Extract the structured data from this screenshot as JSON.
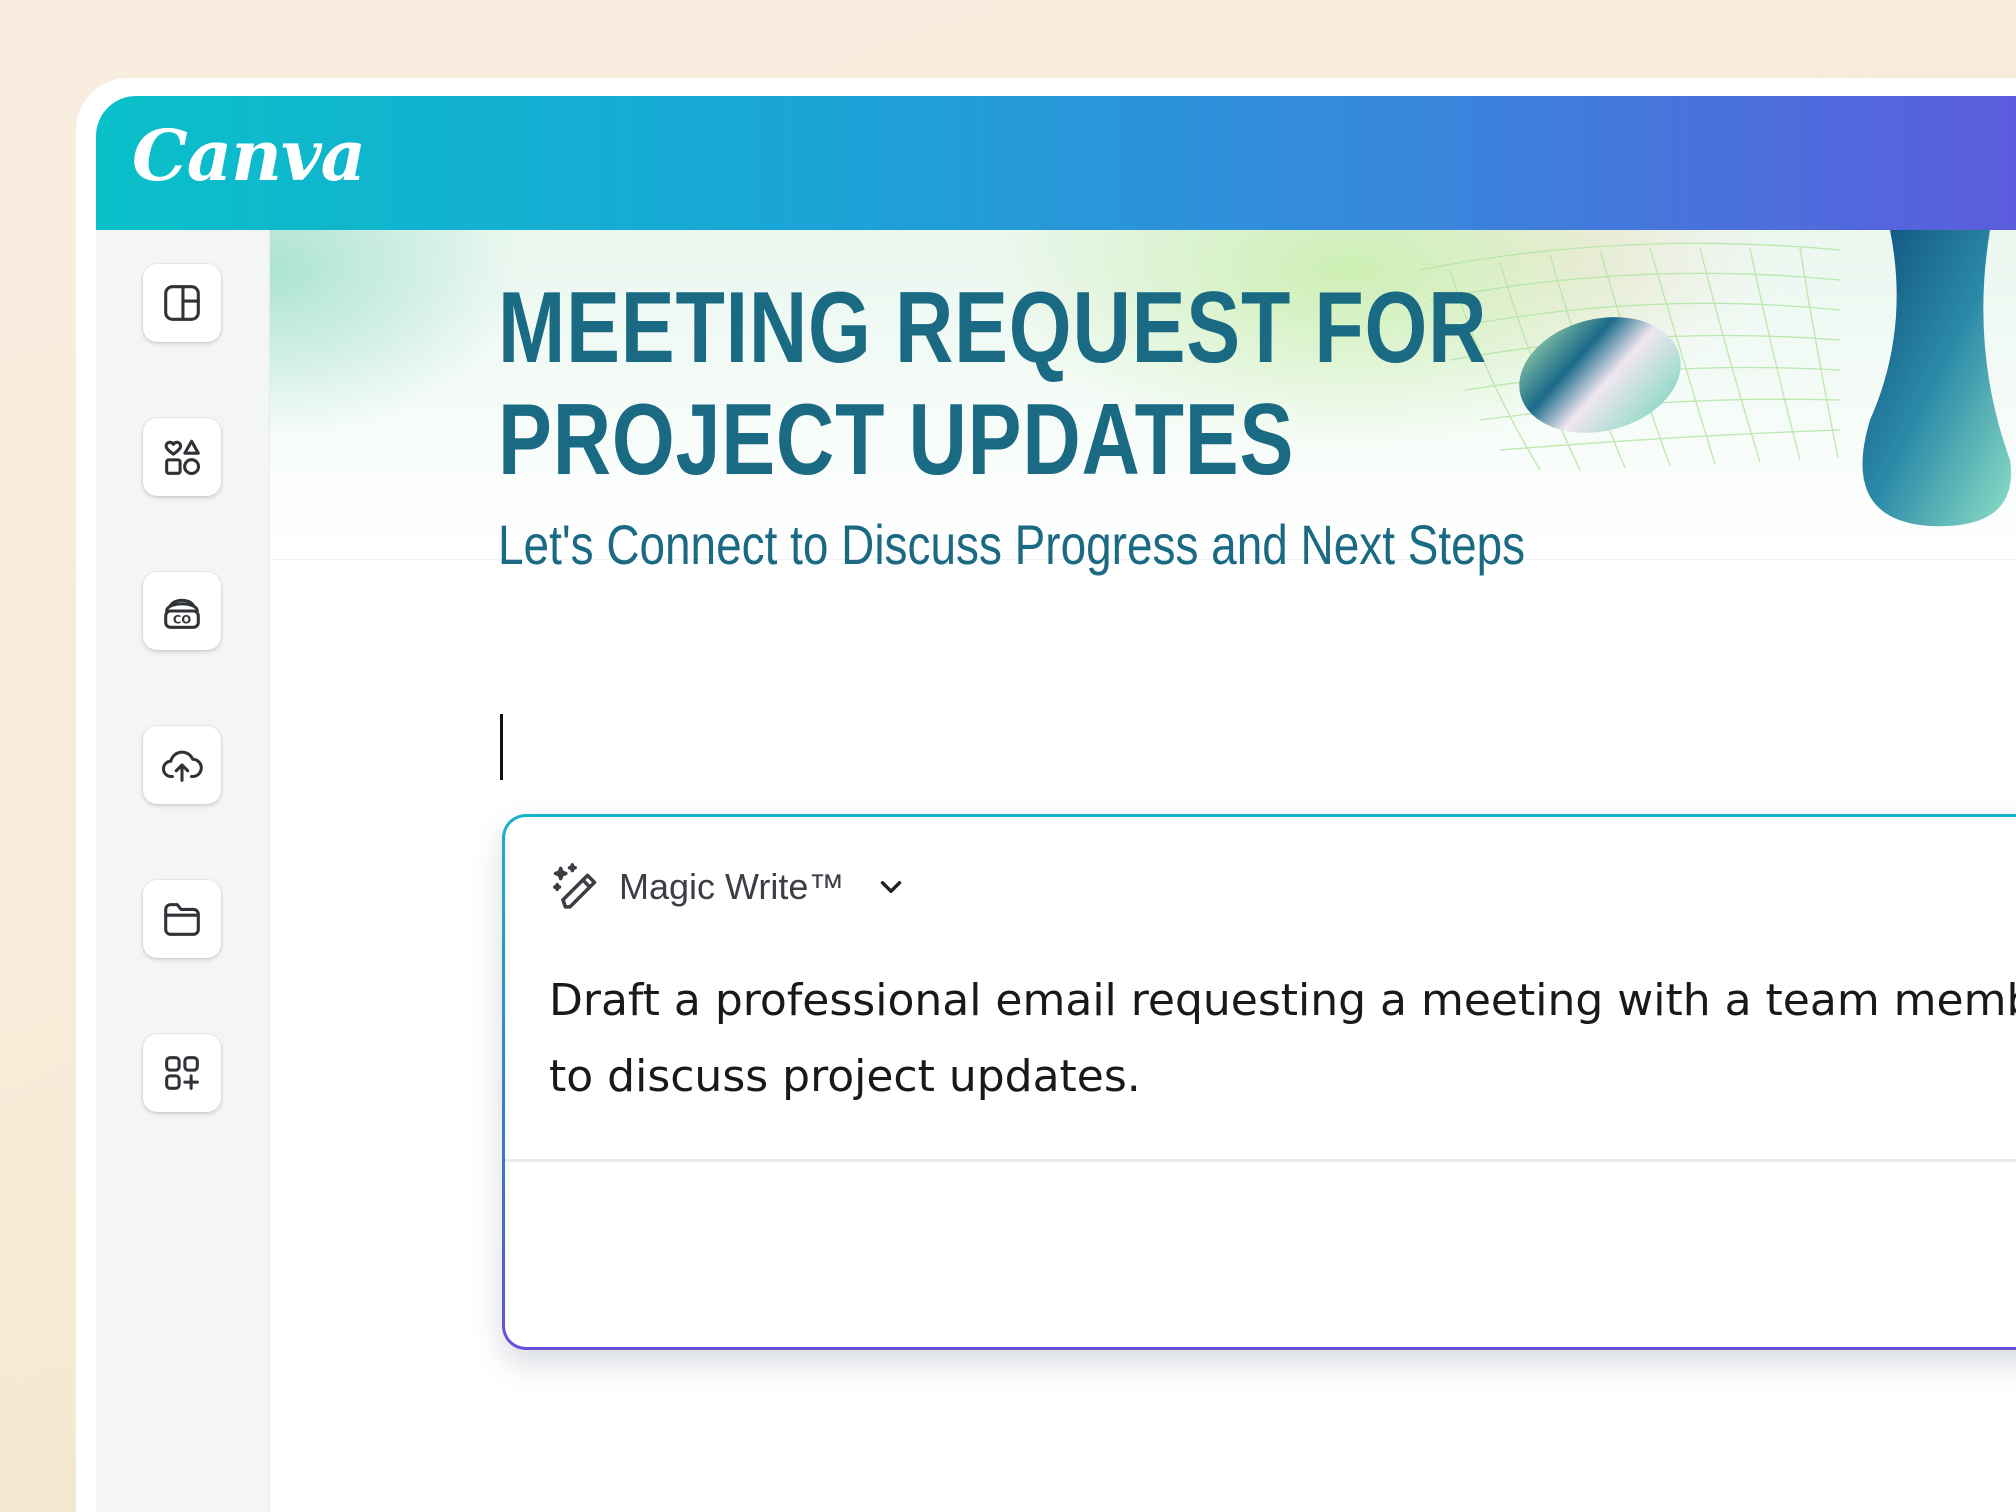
{
  "app": {
    "logo_text": "Canva"
  },
  "sidebar": {
    "items": [
      {
        "name": "design",
        "icon": "layout-icon"
      },
      {
        "name": "elements",
        "icon": "shapes-icon"
      },
      {
        "name": "brand",
        "icon": "brand-kit-icon"
      },
      {
        "name": "uploads",
        "icon": "cloud-upload-icon"
      },
      {
        "name": "projects",
        "icon": "folder-icon"
      },
      {
        "name": "apps",
        "icon": "apps-add-icon"
      }
    ]
  },
  "document": {
    "title_line1": "MEETING REQUEST FOR",
    "title_line2": "PROJECT UPDATES",
    "subtitle": "Let's Connect to Discuss Progress and Next Steps",
    "colors": {
      "title": "#1b6a83",
      "topbar_start": "#0ac0c9",
      "topbar_end": "#5c5bdd"
    }
  },
  "magic_write": {
    "label": "Magic Write™",
    "icon": "magic-pen-icon",
    "prompt": "Draft a professional email requesting a meeting with a team member to discuss project updates."
  }
}
